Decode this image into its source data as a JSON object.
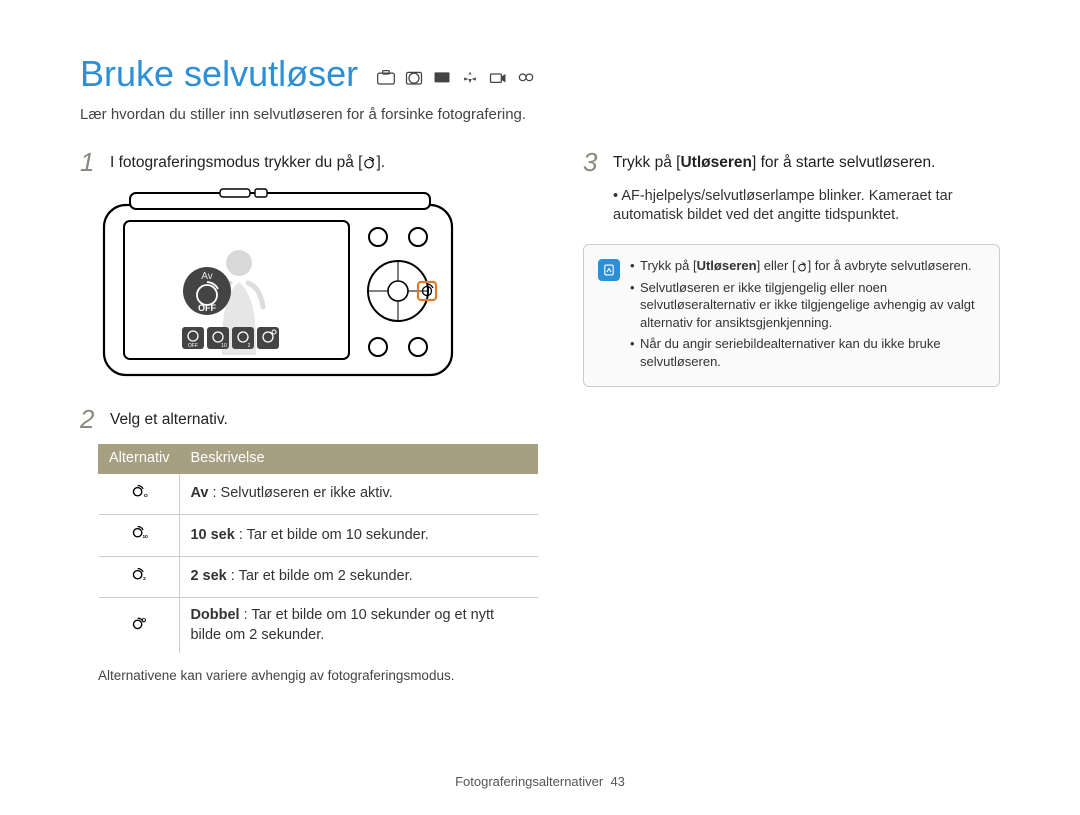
{
  "title": "Bruke selvutløser",
  "title_mode_icons": [
    "smart-auto",
    "program",
    "scene",
    "dual-is",
    "movie",
    "smart-movie"
  ],
  "intro": "Lær hvordan du stiller inn selvutløseren for å forsinke fotografering.",
  "left": {
    "step1_prefix": "I fotograferingsmodus trykker du på [",
    "step1_suffix": "].",
    "step2": "Velg et alternativ.",
    "camera_overlay": {
      "label": "Av",
      "state": "OFF",
      "option_icons": [
        "timer-off",
        "timer-10",
        "timer-2",
        "timer-double"
      ]
    },
    "table": {
      "headers": [
        "Alternativ",
        "Beskrivelse"
      ],
      "rows": [
        {
          "icon": "timer-off",
          "icon_label": "OFF",
          "label": "Av",
          "desc": " : Selvutløseren er ikke aktiv."
        },
        {
          "icon": "timer-10",
          "icon_label": "10",
          "label": "10 sek",
          "desc": " : Tar et bilde om 10 sekunder."
        },
        {
          "icon": "timer-2",
          "icon_label": "2",
          "label": "2 sek",
          "desc": " : Tar et bilde om 2 sekunder."
        },
        {
          "icon": "timer-double",
          "icon_label": "o",
          "label": "Dobbel",
          "desc": " : Tar et bilde om 10 sekunder og et nytt bilde om 2 sekunder."
        }
      ]
    },
    "footnote": "Alternativene kan variere avhengig av fotograferingsmodus."
  },
  "right": {
    "step3_prefix": "Trykk på [",
    "step3_bold": "Utløseren",
    "step3_suffix": "] for å starte selvutløseren.",
    "step3_bullet": "AF-hjelpelys/selvutløserlampe blinker. Kameraet tar automatisk bildet ved det angitte tidspunktet.",
    "info": {
      "item1_prefix": "Trykk på [",
      "item1_bold": "Utløseren",
      "item1_mid": "] eller [",
      "item1_suffix": "] for å avbryte selvutløseren.",
      "item2": "Selvutløseren er ikke tilgjengelig eller noen selvutløseralternativ er ikke tilgjengelige avhengig av valgt alternativ for ansiktsgjenkjenning.",
      "item3": "Når du angir seriebildealternativer kan du ikke bruke selvutløseren."
    }
  },
  "footer_label": "Fotograferingsalternativer",
  "footer_page": "43"
}
